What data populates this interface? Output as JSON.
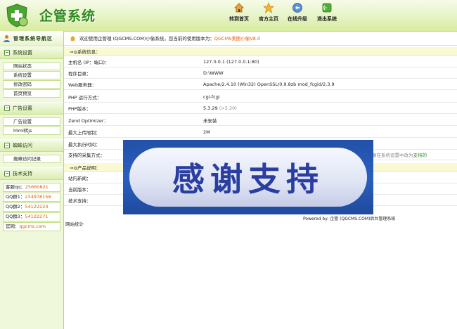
{
  "header": {
    "logo_text": "企管系统",
    "nav": [
      {
        "label": "转到首页",
        "icon": "home-icon"
      },
      {
        "label": "官方主页",
        "icon": "star-icon"
      },
      {
        "label": "在线升级",
        "icon": "upgrade-icon"
      },
      {
        "label": "退出系统",
        "icon": "exit-icon"
      }
    ]
  },
  "sidebar": {
    "title": "管理系统导航区",
    "sections": [
      {
        "title": "系统设置",
        "items": [
          "网站状态",
          "系统设置",
          "修改密码",
          "首页预览"
        ]
      },
      {
        "title": "广告设置",
        "items": [
          "广告设置",
          "html转js"
        ]
      },
      {
        "title": "蜘蛛访问",
        "items": [
          "蜘蛛访问记录"
        ]
      },
      {
        "title": "技术支持"
      }
    ],
    "contacts": [
      {
        "label": "客服qq：",
        "value": "25660621"
      },
      {
        "label": "QQ群1：",
        "value": "234978158"
      },
      {
        "label": "QQ群2：",
        "value": "54122224"
      },
      {
        "label": "QQ群3：",
        "value": "54122271"
      },
      {
        "label": "官网：",
        "value": "qgcms.com"
      }
    ]
  },
  "main": {
    "welcome_prefix": "欢迎使用企管理 (QGCMS.COM)小偷系统，您当前的使用版本为：",
    "welcome_version": "QGCMS美图小偷V8.0",
    "system_info_title": "⇒◎系统信息：",
    "rows": [
      {
        "key": "主机名 (IP：端口)：",
        "value": "127.0.0.1  (127.0.0.1:80)"
      },
      {
        "key": "程序目录：",
        "value": "D:\\WWW"
      },
      {
        "key": "Web服务器：",
        "value": "Apache/2.4.10 (Win32) OpenSSL/0.9.8zb mod_fcgid/2.3.9"
      },
      {
        "key": "PHP 运行方式：",
        "value": "cgi-fcgi"
      },
      {
        "key": "PHP版本：",
        "value": "5.3.29",
        "note": "(>5.20)"
      },
      {
        "key": "Zend Optimizer：",
        "value": "未安装"
      },
      {
        "key": "最大上传限制：",
        "value": "2M"
      },
      {
        "key": "最大执行时间：",
        "value": ""
      },
      {
        "key": "支持的采集方式：",
        "value": "",
        "trailing_prefix": "像在系统设置中改为",
        "trailing_highlight": "支持的"
      }
    ],
    "product_title": "⇒◎产品说明：",
    "product_rows": [
      {
        "key": "站内新闻：",
        "value": ""
      },
      {
        "key": "当前版本：",
        "value": ""
      },
      {
        "key": "技术支持：",
        "value": ""
      }
    ],
    "footer": "Powered by:  企管 (QGCMS.COM)后台管理系统",
    "stat": "网站统计"
  },
  "overlay": {
    "text": "感谢支持"
  },
  "colors": {
    "accent": "#e35d00",
    "brand_green": "#2f8a1f",
    "banner_blue": "#2350a8"
  }
}
